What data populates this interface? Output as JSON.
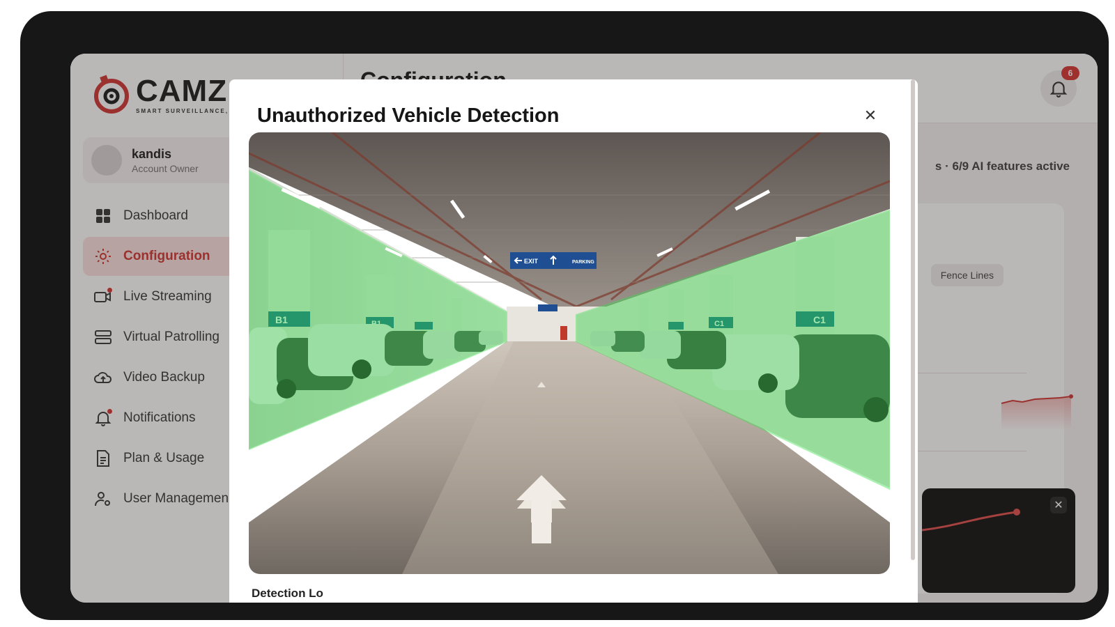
{
  "app": {
    "logo_word": "CAMZ",
    "logo_tagline": "SMART SURVEILLANCE, S"
  },
  "profile": {
    "name": "kandis",
    "role": "Account Owner"
  },
  "sidebar": {
    "items": [
      {
        "label": "Dashboard",
        "icon": "dashboard-icon",
        "active": false
      },
      {
        "label": "Configuration",
        "icon": "gear-icon",
        "active": true
      },
      {
        "label": "Live Streaming",
        "icon": "camera-icon",
        "active": false
      },
      {
        "label": "Virtual Patrolling",
        "icon": "patrol-icon",
        "active": false
      },
      {
        "label": "Video Backup",
        "icon": "cloud-icon",
        "active": false
      },
      {
        "label": "Notifications",
        "icon": "bell-icon",
        "active": false
      },
      {
        "label": "Plan & Usage",
        "icon": "document-icon",
        "active": false
      },
      {
        "label": "User Managemen",
        "icon": "user-icon",
        "active": false
      }
    ]
  },
  "header": {
    "title": "Configuration",
    "notification_count": "6"
  },
  "main": {
    "features_status": "s · 6/9 AI features active",
    "chip_label": "Fence Lines",
    "close_glyph": "✕"
  },
  "modal": {
    "title": "Unauthorized Vehicle Detection",
    "close_glyph": "✕",
    "footer_text": "Detection Lo",
    "camera": {
      "signs": [
        "EXIT",
        "PARKING"
      ],
      "bay_labels_left": [
        "B1",
        "B1",
        "B1",
        "B1"
      ],
      "bay_labels_right": [
        "C1",
        "C1",
        "C1"
      ],
      "zone_color": "#2ecc40"
    }
  },
  "colors": {
    "accent": "#d13a35",
    "active_bg": "#fbe3e1",
    "device_frame": "#171717"
  }
}
